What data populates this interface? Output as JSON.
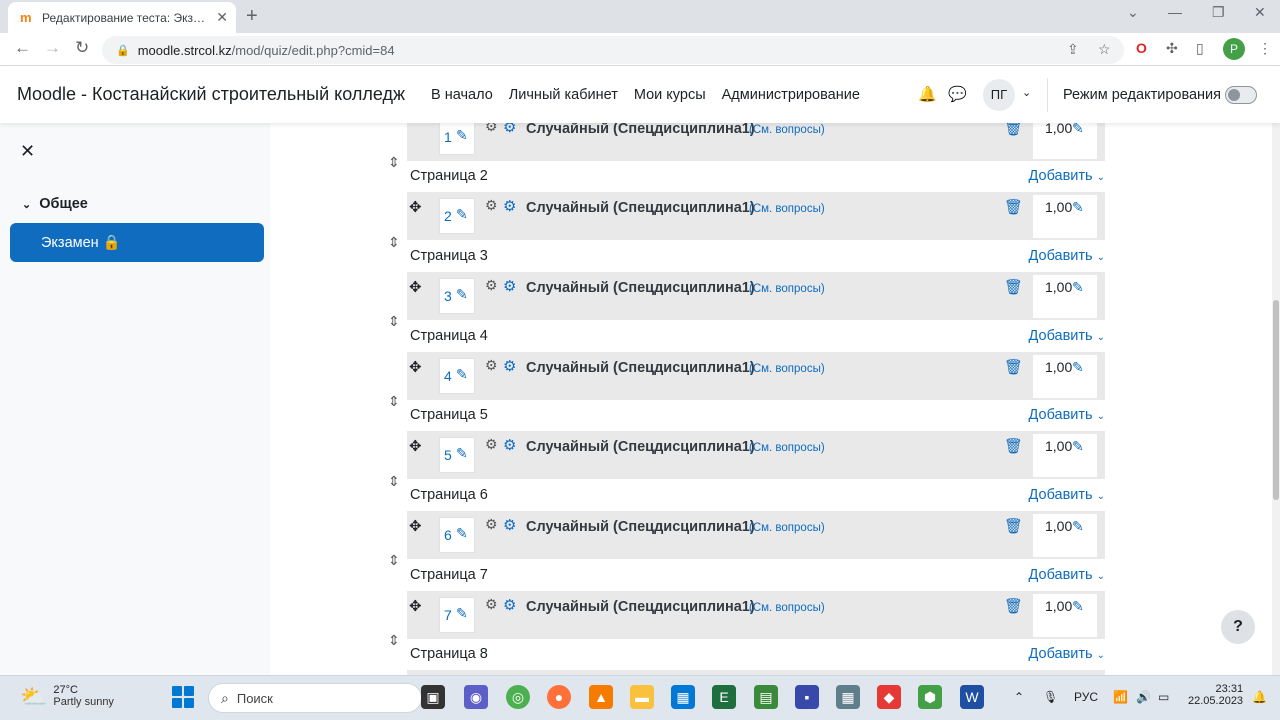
{
  "browser": {
    "tab_title": "Редактирование теста: Экзамен",
    "url_domain": "moodle.strcol.kz",
    "url_path": "/mod/quiz/edit.php?cmid=84",
    "profile_initial": "P"
  },
  "navbar": {
    "site_name": "Moodle - Костанайский строительный колледж",
    "links": [
      "В начало",
      "Личный кабинет",
      "Мои курсы",
      "Администрирование"
    ],
    "user_initials": "ПГ",
    "edit_mode_label": "Режим редактирования",
    "edit_mode_on": false
  },
  "drawer": {
    "section_label": "Общее",
    "active_item": "Экзамен"
  },
  "quiz": {
    "add_label": "Добавить",
    "page_prefix": "Страница",
    "pages": [
      {
        "page": "Страница 2",
        "slot": "2"
      },
      {
        "page": "Страница 3",
        "slot": "3"
      },
      {
        "page": "Страница 4",
        "slot": "4"
      },
      {
        "page": "Страница 5",
        "slot": "5"
      },
      {
        "page": "Страница 6",
        "slot": "6"
      },
      {
        "page": "Страница 7",
        "slot": "7"
      },
      {
        "page": "Страница 8",
        "slot": ""
      }
    ],
    "first_slot": "1",
    "question_name": "Случайный (Спецдисциплина1)",
    "question_link": "(См. вопросы)",
    "mark": "1,00"
  },
  "help_label": "?",
  "taskbar": {
    "temperature": "27°C",
    "weather": "Partly sunny",
    "search_placeholder": "Поиск",
    "language": "РУС",
    "time": "23:31",
    "date": "22.05.2023"
  }
}
